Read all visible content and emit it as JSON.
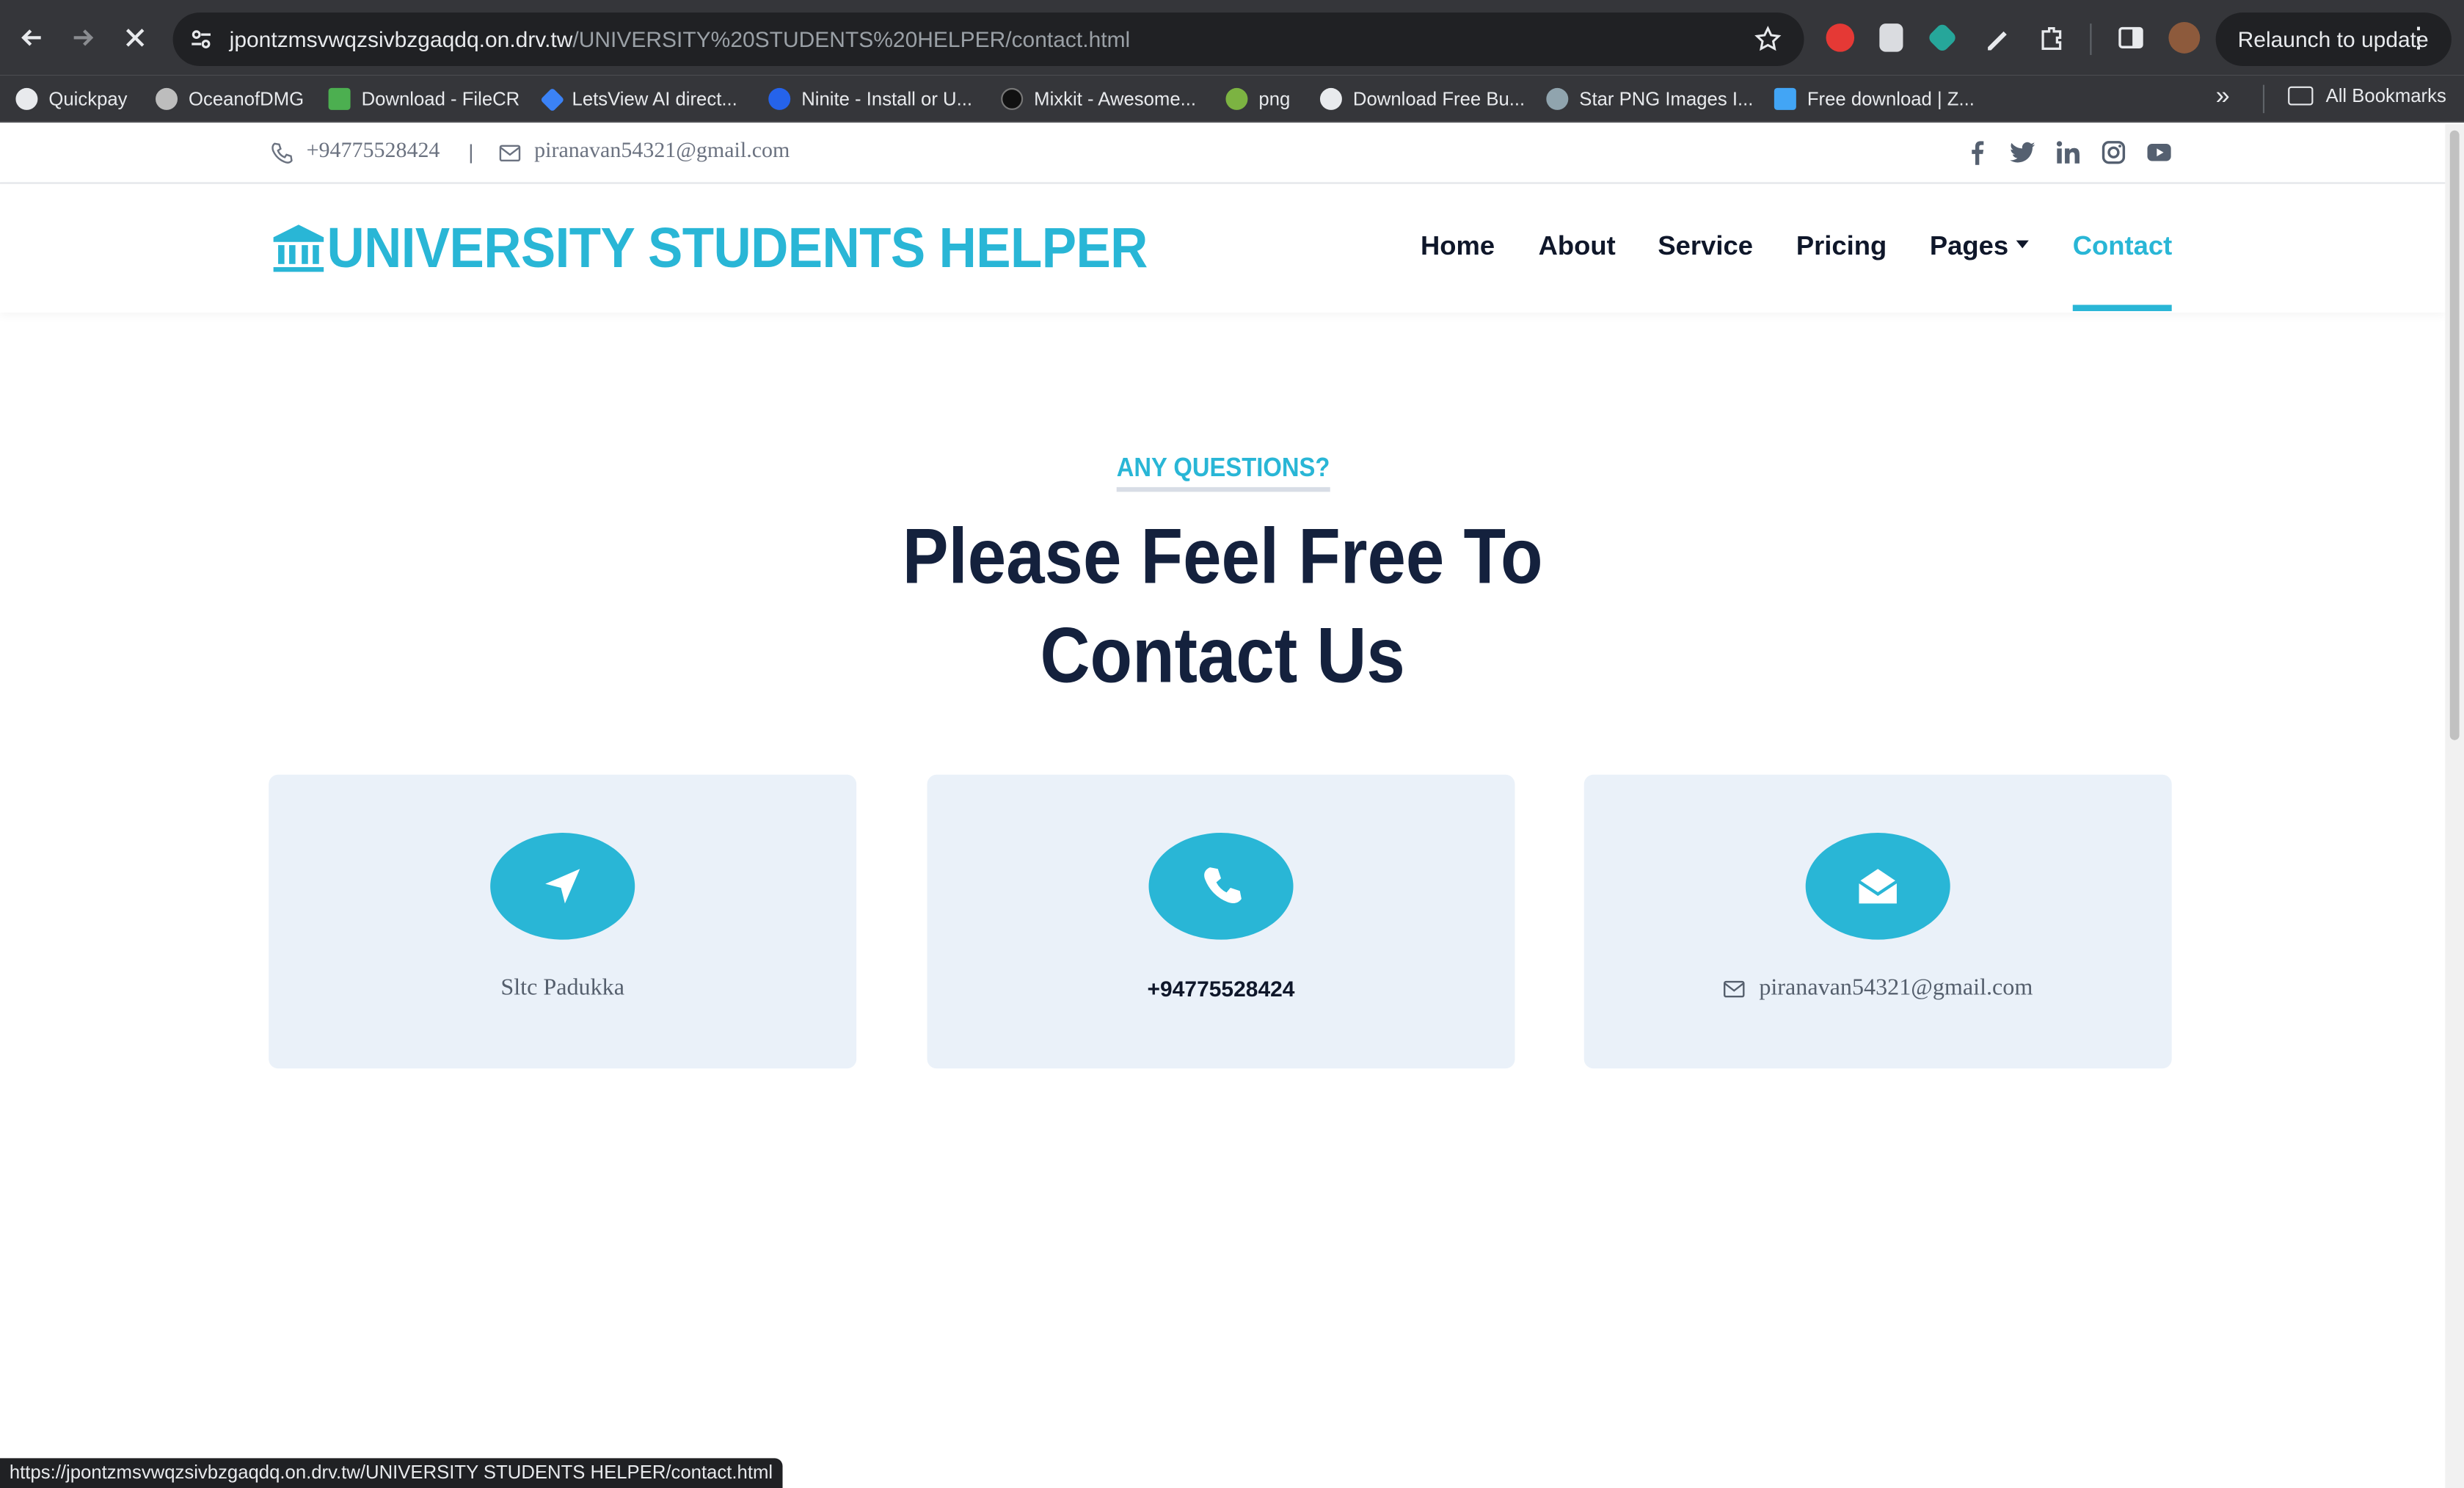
{
  "browser": {
    "url_host": "jpontzmsvwqzsivbzgaqdq.on.drv.tw",
    "url_path": "/UNIVERSITY%20STUDENTS%20HELPER/contact.html",
    "relaunch_label": "Relaunch to update",
    "bookmarks": [
      {
        "label": "Quickpay",
        "color": "#e8eaed"
      },
      {
        "label": "OceanofDMG",
        "color": "#bdbdbd"
      },
      {
        "label": "Download - FileCR",
        "color": "#4caf50"
      },
      {
        "label": "LetsView AI direct...",
        "color": "#3b82f6"
      },
      {
        "label": "Ninite - Install or U...",
        "color": "#2563eb"
      },
      {
        "label": "Mixkit - Awesome...",
        "color": "#111111"
      },
      {
        "label": "png",
        "color": "#7cb342"
      },
      {
        "label": "Download Free Bu...",
        "color": "#e8eaed"
      },
      {
        "label": "Star PNG Images I...",
        "color": "#90a4ae"
      },
      {
        "label": "Free download | Z...",
        "color": "#42a5f5"
      }
    ],
    "all_bookmarks_label": "All Bookmarks",
    "status_url": "https://jpontzmsvwqzsivbzgaqdq.on.drv.tw/UNIVERSITY STUDENTS HELPER/contact.html"
  },
  "topbar": {
    "phone": "+94775528424",
    "separator": "|",
    "email": "piranavan54321@gmail.com",
    "socials": [
      "facebook-icon",
      "twitter-icon",
      "linkedin-icon",
      "instagram-icon",
      "youtube-icon"
    ]
  },
  "navbar": {
    "logo_text": "UNIVERSITY STUDENTS HELPER",
    "menu": [
      {
        "label": "Home"
      },
      {
        "label": "About"
      },
      {
        "label": "Service"
      },
      {
        "label": "Pricing"
      },
      {
        "label": "Pages"
      },
      {
        "label": "Contact"
      }
    ],
    "active": "Contact"
  },
  "hero": {
    "eyebrow": "ANY QUESTIONS?",
    "headline_line1": "Please Feel Free To",
    "headline_line2": "Contact Us"
  },
  "cards": [
    {
      "icon": "location-arrow-icon",
      "text": "Sltc Padukka"
    },
    {
      "icon": "phone-icon",
      "text": "+94775528424"
    },
    {
      "icon": "envelope-open-icon",
      "text": "piranavan54321@gmail.com"
    }
  ],
  "colors": {
    "accent": "#29b6d6",
    "dark": "#14213d",
    "card_bg": "#eaf1f9"
  }
}
